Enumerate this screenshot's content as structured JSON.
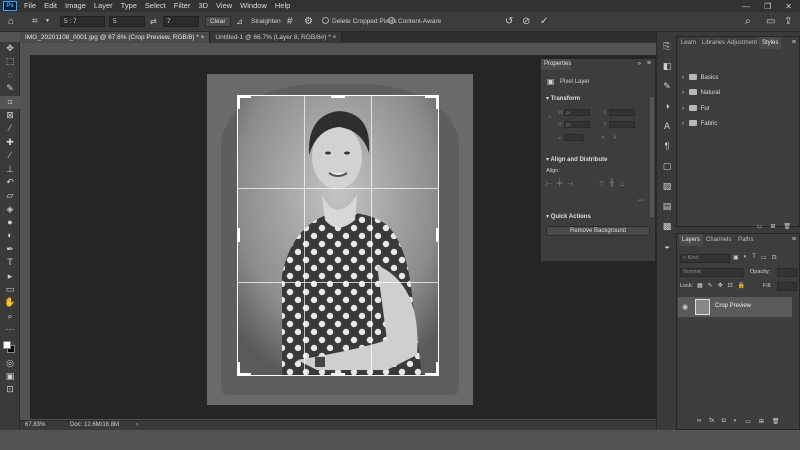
{
  "app": {
    "logo": "Ps",
    "menu": [
      "File",
      "Edit",
      "Image",
      "Layer",
      "Type",
      "Select",
      "Filter",
      "3D",
      "View",
      "Window",
      "Help"
    ]
  },
  "options_bar": {
    "ratio_value": "5 : 7",
    "width_value": "5",
    "height_value": "7",
    "clear_label": "Clear",
    "straighten_label": "Straighten",
    "delete_cropped_label": "Delete Cropped Pixels",
    "content_aware_label": "Content-Aware"
  },
  "tabs": [
    {
      "label": "IMG_20201108_0001.jpg @ 67.8% (Crop Preview, RGB/8) *",
      "active": true
    },
    {
      "label": "Untitled-1 @ 66.7% (Layer 8, RGB/8#) *",
      "active": false
    }
  ],
  "status": {
    "zoom": "67.83%",
    "doc": "Doc: 12.6M/16.8M"
  },
  "properties": {
    "tab": "Properties",
    "layer_type": "Pixel Layer",
    "transform_title": "Transform",
    "labels": {
      "w": "W",
      "h": "H",
      "x": "X",
      "y": "Y",
      "w_unit": "px",
      "h_unit": "px"
    },
    "align_title": "Align and Distribute",
    "align_label": "Align:",
    "quick_actions_title": "Quick Actions",
    "remove_bg_label": "Remove Background"
  },
  "libraries_panel": {
    "tabs": [
      "Learn",
      "Libraries",
      "Adjustment",
      "Styles"
    ],
    "active_tab": "Styles",
    "folders": [
      "Basics",
      "Natural",
      "Fur",
      "Fabric"
    ]
  },
  "layers_panel": {
    "tabs": [
      "Layers",
      "Channels",
      "Paths"
    ],
    "active_tab": "Layers",
    "search_placeholder": "Kind",
    "blend_mode": "Normal",
    "opacity_label": "Opacity:",
    "lock_label": "Lock:",
    "fill_label": "Fill:",
    "layers": [
      {
        "name": "Crop Preview"
      }
    ],
    "footer_icons": [
      "link-icon",
      "fx-icon",
      "mask-icon",
      "adjustment-icon",
      "group-icon",
      "new-layer-icon",
      "trash-icon"
    ]
  },
  "colors": {
    "accent": "#31a8ff",
    "canvas_bg": "#252525",
    "panel_bg": "#3d3d3d"
  }
}
